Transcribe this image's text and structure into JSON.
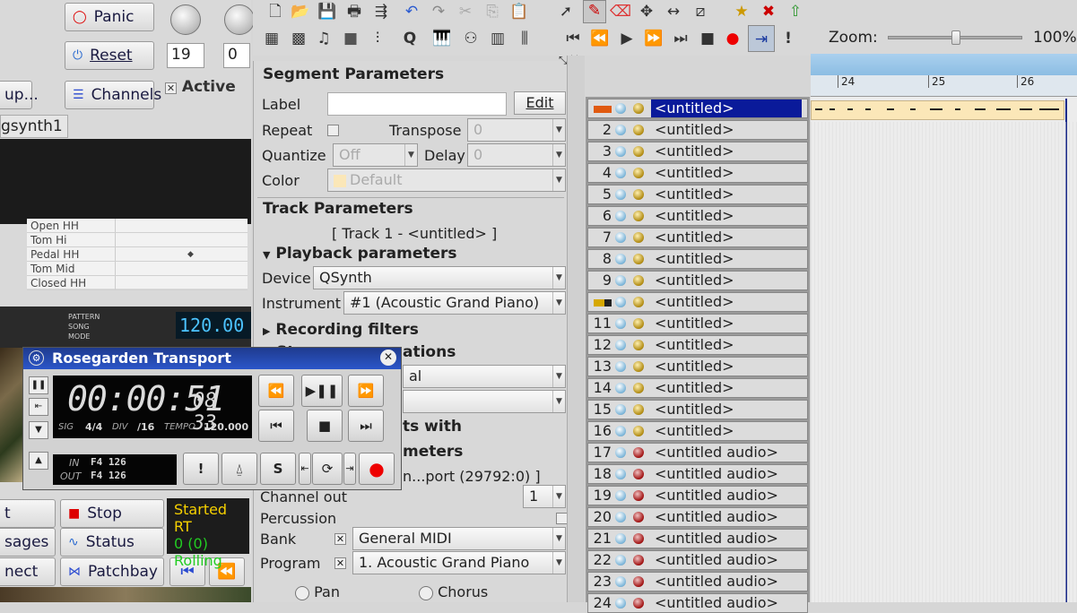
{
  "qsynth": {
    "panic": "Panic",
    "reset": "Reset",
    "channels": "Channels",
    "active": "Active",
    "spin1": "19",
    "spin2": "0",
    "setup_partial": "up...",
    "tab_partial": "gsynth1",
    "stop": "Stop",
    "messages_partial": "sages",
    "status": "Status",
    "connect_partial": "nect",
    "patchbay": "Patchbay",
    "start_partial": "t",
    "status_lines": [
      "Started RT",
      "0 (0)",
      "Rolling"
    ]
  },
  "hydrogen": {
    "instruments": [
      "Open HH",
      "Tom Hi",
      "Pedal HH",
      "Tom Mid",
      "Closed HH"
    ],
    "modes": [
      "PATTERN",
      "SONG",
      "MODE"
    ],
    "bpm": "120.00"
  },
  "segment_params": {
    "title": "Segment Parameters",
    "label": "Label",
    "edit": "Edit",
    "repeat": "Repeat",
    "transpose": "Transpose",
    "transpose_val": "0",
    "quantize": "Quantize",
    "quantize_val": "Off",
    "delay": "Delay",
    "delay_val": "0",
    "color": "Color",
    "color_val": "Default"
  },
  "track_params": {
    "title": "Track Parameters",
    "track_name": "[ Track 1 - <untitled> ]",
    "playback": "Playback parameters",
    "device": "Device",
    "device_val": "QSynth",
    "instrument": "Instrument",
    "instrument_val": "#1 (Acoustic Grand Piano)",
    "recording": "Recording filters",
    "staff_partial": "St",
    "staff_partial2": "ations",
    "combo1_partial": "al",
    "with_partial": "ts with",
    "meters_partial": "meters",
    "port_partial": "n...port (29792:0) ]",
    "channel_out": "Channel out",
    "channel_val": "1",
    "percussion": "Percussion",
    "bank": "Bank",
    "bank_val": "General MIDI",
    "program": "Program",
    "program_val": "1. Acoustic Grand Piano",
    "pan": "Pan",
    "chorus": "Chorus"
  },
  "zoom": {
    "label": "Zoom:",
    "value": "100%"
  },
  "ruler": {
    "bars": [
      "24",
      "25",
      "26"
    ]
  },
  "tracks": [
    {
      "num": "",
      "name": "<untitled>",
      "type": "midi",
      "selected": true
    },
    {
      "num": "2",
      "name": "<untitled>",
      "type": "midi"
    },
    {
      "num": "3",
      "name": "<untitled>",
      "type": "midi"
    },
    {
      "num": "4",
      "name": "<untitled>",
      "type": "midi"
    },
    {
      "num": "5",
      "name": "<untitled>",
      "type": "midi"
    },
    {
      "num": "6",
      "name": "<untitled>",
      "type": "midi"
    },
    {
      "num": "7",
      "name": "<untitled>",
      "type": "midi"
    },
    {
      "num": "8",
      "name": "<untitled>",
      "type": "midi"
    },
    {
      "num": "9",
      "name": "<untitled>",
      "type": "midi"
    },
    {
      "num": "",
      "name": "<untitled>",
      "type": "midi"
    },
    {
      "num": "11",
      "name": "<untitled>",
      "type": "midi"
    },
    {
      "num": "12",
      "name": "<untitled>",
      "type": "midi"
    },
    {
      "num": "13",
      "name": "<untitled>",
      "type": "midi"
    },
    {
      "num": "14",
      "name": "<untitled>",
      "type": "midi"
    },
    {
      "num": "15",
      "name": "<untitled>",
      "type": "midi"
    },
    {
      "num": "16",
      "name": "<untitled>",
      "type": "midi"
    },
    {
      "num": "17",
      "name": "<untitled audio>",
      "type": "audio"
    },
    {
      "num": "18",
      "name": "<untitled audio>",
      "type": "audio"
    },
    {
      "num": "19",
      "name": "<untitled audio>",
      "type": "audio"
    },
    {
      "num": "20",
      "name": "<untitled audio>",
      "type": "audio"
    },
    {
      "num": "21",
      "name": "<untitled audio>",
      "type": "audio"
    },
    {
      "num": "22",
      "name": "<untitled audio>",
      "type": "audio"
    },
    {
      "num": "23",
      "name": "<untitled audio>",
      "type": "audio"
    },
    {
      "num": "24",
      "name": "<untitled audio>",
      "type": "audio"
    }
  ],
  "transport": {
    "title": "Rosegarden Transport",
    "time": "00:00:51",
    "frac": "08 33",
    "sig_label": "SIG",
    "sig": "4/4",
    "div_label": "DIV",
    "div": "/16",
    "tempo_label": "TEMPO",
    "tempo": "120.000",
    "in_label": "IN",
    "in_val": "F4 126",
    "out_label": "OUT",
    "out_val": "F4 126"
  },
  "colors": {
    "selection": "#0a1a9a",
    "ruler": "#aad0ee",
    "record": "#e00000",
    "title_bar": "#2b56c9"
  }
}
